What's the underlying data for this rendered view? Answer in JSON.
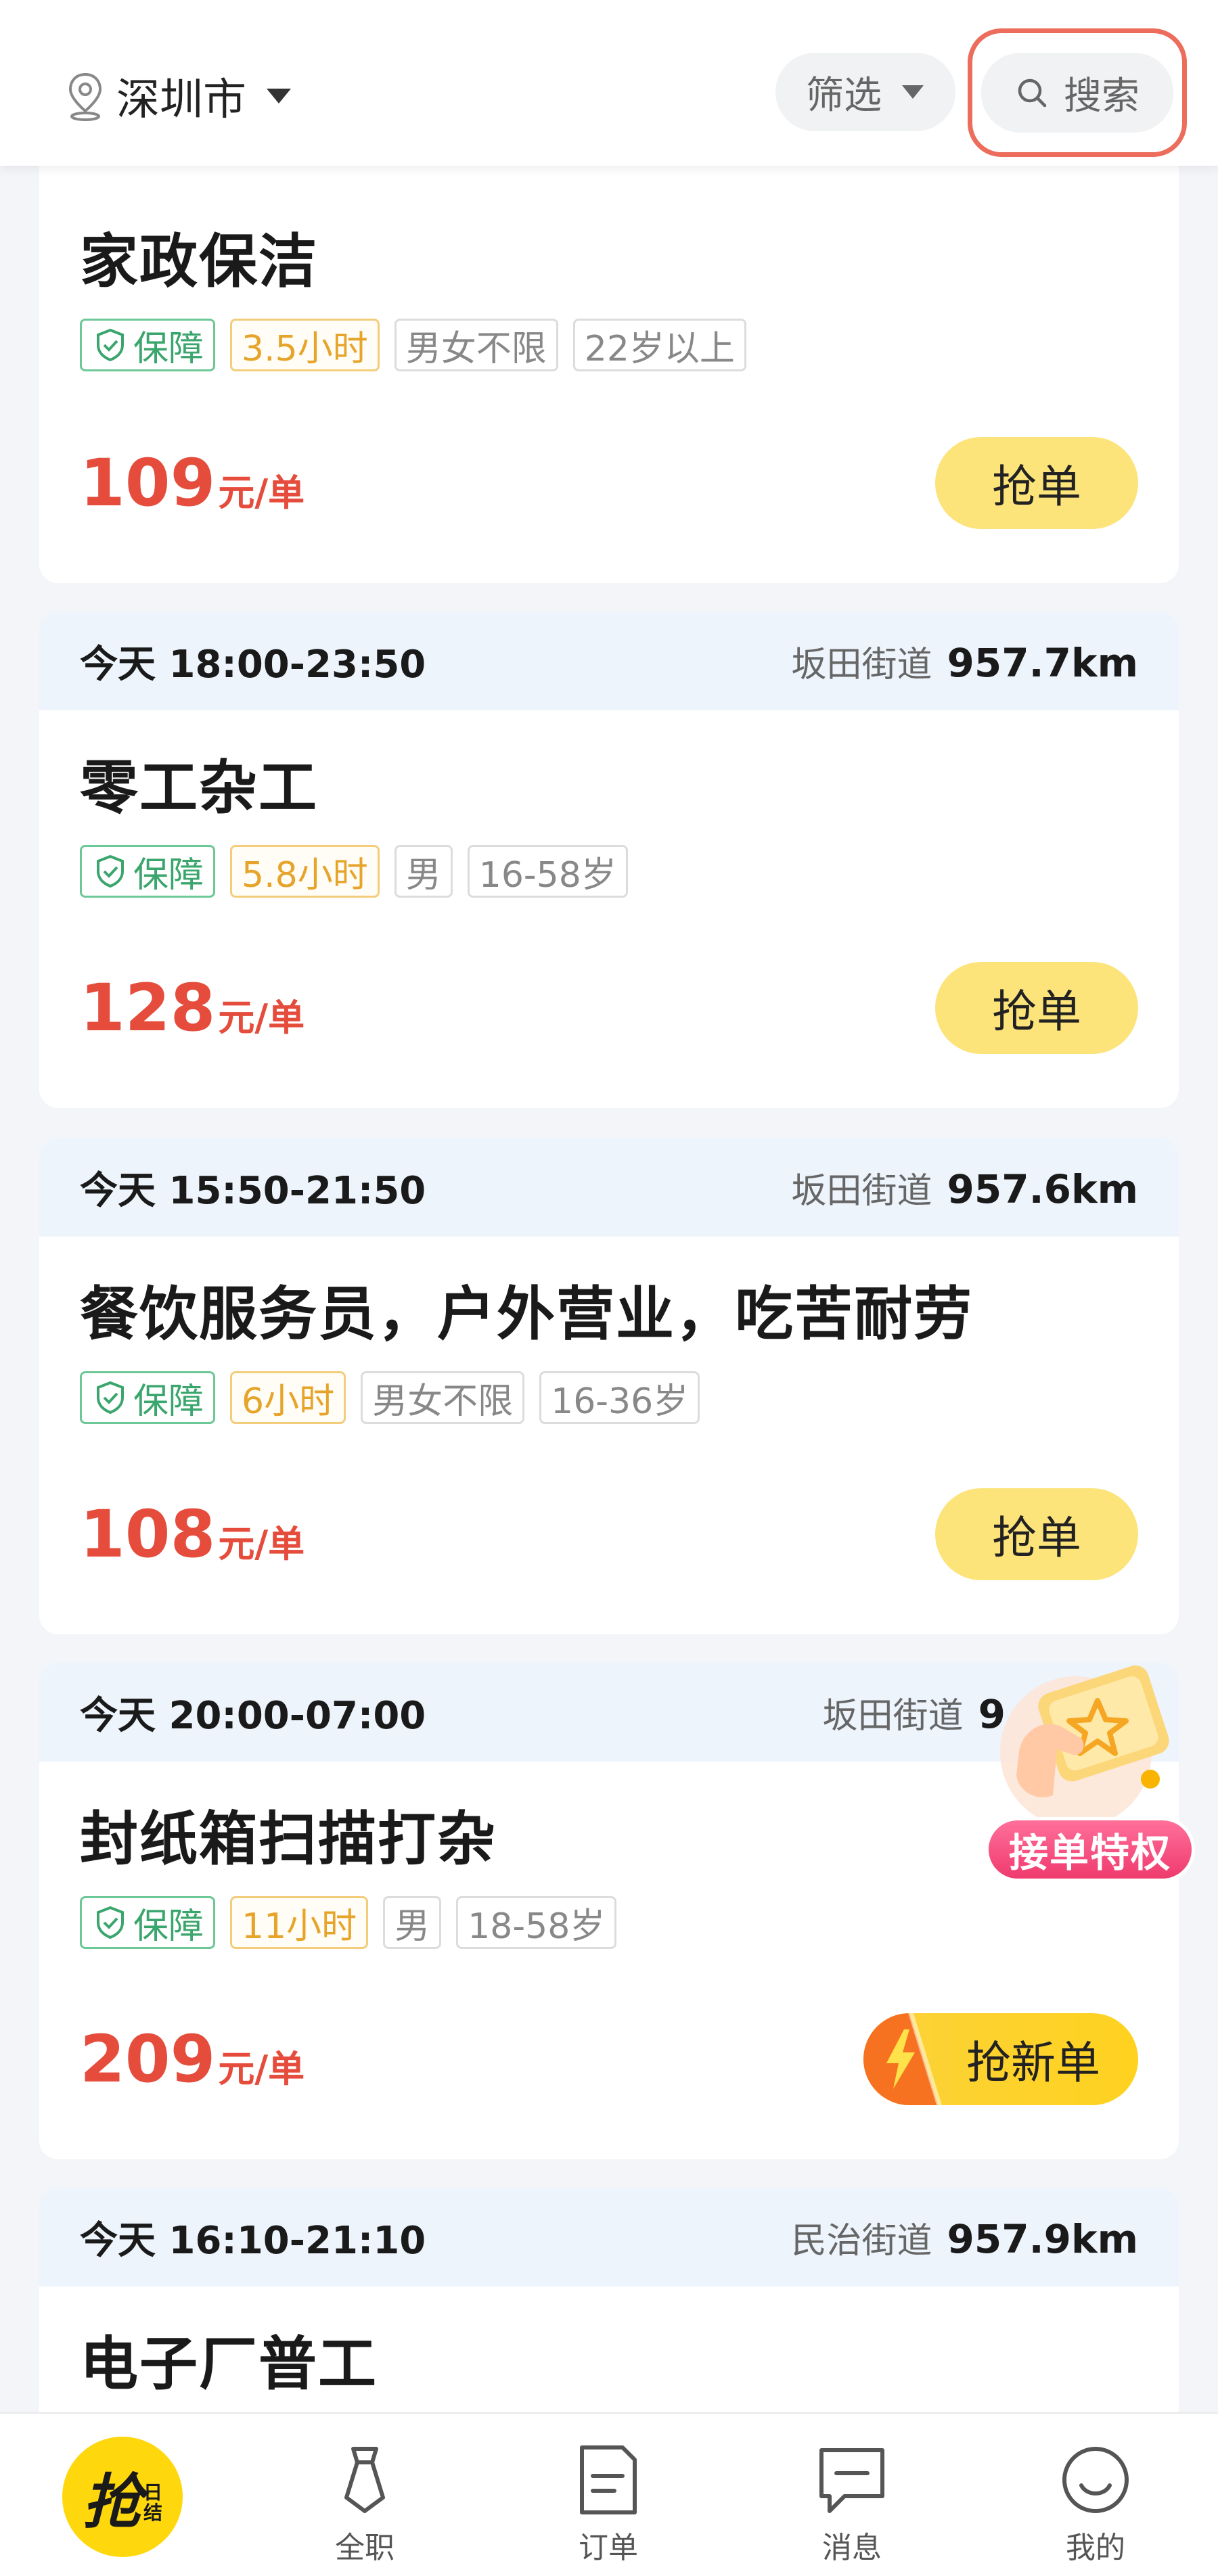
{
  "header": {
    "city": "深圳市",
    "filter_label": "筛选",
    "search_label": "搜索"
  },
  "jobs": [
    {
      "time": "",
      "street": "",
      "distance": "",
      "title": "家政保洁",
      "tags": [
        "保障",
        "3.5小时",
        "男女不限",
        "22岁以上"
      ],
      "price": "109",
      "unit": "元/单",
      "action": "抢单"
    },
    {
      "time": "今天 18:00-23:50",
      "street": "坂田街道",
      "distance": "957.7km",
      "title": "零工杂工",
      "tags": [
        "保障",
        "5.8小时",
        "男",
        "16-58岁"
      ],
      "price": "128",
      "unit": "元/单",
      "action": "抢单"
    },
    {
      "time": "今天 15:50-21:50",
      "street": "坂田街道",
      "distance": "957.6km",
      "title": "餐饮服务员，户外营业，吃苦耐劳",
      "tags": [
        "保障",
        "6小时",
        "男女不限",
        "16-36岁"
      ],
      "price": "108",
      "unit": "元/单",
      "action": "抢单"
    },
    {
      "time": "今天 20:00-07:00",
      "street": "坂田街道",
      "distance": "9",
      "title": "封纸箱扫描打杂",
      "tags": [
        "保障",
        "11小时",
        "男",
        "18-58岁"
      ],
      "price": "209",
      "unit": "元/单",
      "action": "抢新单"
    },
    {
      "time": "今天 16:10-21:10",
      "street": "民治街道",
      "distance": "957.9km",
      "title": "电子厂普工"
    }
  ],
  "badge": {
    "label": "接单特权"
  },
  "bottom_nav": {
    "grab_main": "抢",
    "grab_sub_1": "日",
    "grab_sub_2": "结",
    "items": [
      "全职",
      "订单",
      "消息",
      "我的"
    ]
  },
  "colors": {
    "price_red": "#e54c3c",
    "grab_yellow": "#fce47a",
    "guard_green": "#3aa56c",
    "hours_orange": "#e6a42a",
    "search_highlight": "#ec6d5c"
  }
}
